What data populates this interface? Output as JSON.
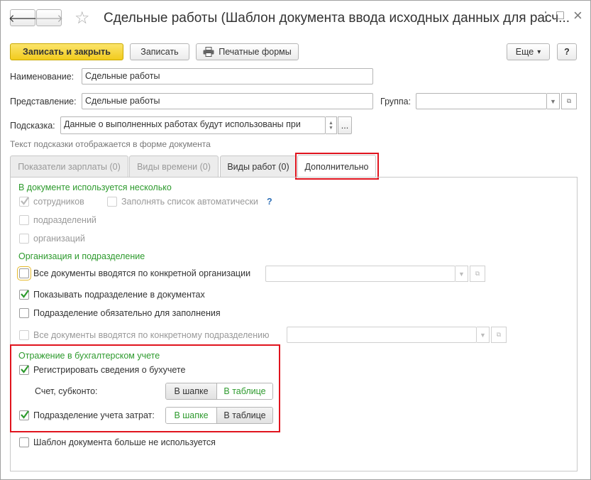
{
  "window": {
    "title": "Сдельные работы (Шаблон документа ввода исходных данных для расч...",
    "back_glyph": "🡐",
    "forward_glyph": "🡒",
    "star_glyph": "☆",
    "menu_glyph": "⋮",
    "maximize_glyph": "□",
    "close_glyph": "×"
  },
  "toolbar": {
    "save_close": "Записать и закрыть",
    "save": "Записать",
    "print_forms": "Печатные формы",
    "more": "Еще",
    "more_arrow": "▾",
    "help": "?"
  },
  "fields": {
    "name_label": "Наименование:",
    "name_value": "Сдельные работы",
    "repr_label": "Представление:",
    "repr_value": "Сдельные работы",
    "group_label": "Группа:",
    "group_value": "",
    "hint_label": "Подсказка:",
    "hint_value": "Данные о выполненных работах будут использованы при",
    "hint_note": "Текст подсказки отображается в форме документа",
    "ellipsis": "..."
  },
  "tabs": [
    {
      "label": "Показатели зарплаты (0)"
    },
    {
      "label": "Виды времени (0)"
    },
    {
      "label": "Виды работ (0)"
    },
    {
      "label": "Дополнительно"
    }
  ],
  "section1": {
    "title": "В документе используется несколько",
    "employees": "сотрудников",
    "autofill": "Заполнять список автоматически",
    "autofill_help": "?",
    "departments": "подразделений",
    "organizations": "организаций"
  },
  "section2": {
    "title": "Организация и подразделение",
    "all_docs_org": "Все документы вводятся по конкретной организации",
    "show_dept": "Показывать подразделение в документах",
    "dept_required": "Подразделение обязательно для заполнения",
    "all_docs_dept": "Все документы вводятся по конкретному подразделению"
  },
  "section3": {
    "title": "Отражение в бухгалтерском учете",
    "register": "Регистрировать сведения о бухучете",
    "account_label": "Счет, субконто:",
    "cost_dept": "Подразделение учета затрат:",
    "in_header": "В шапке",
    "in_table": "В таблице"
  },
  "footer": {
    "template_unused": "Шаблон документа больше не используется"
  }
}
